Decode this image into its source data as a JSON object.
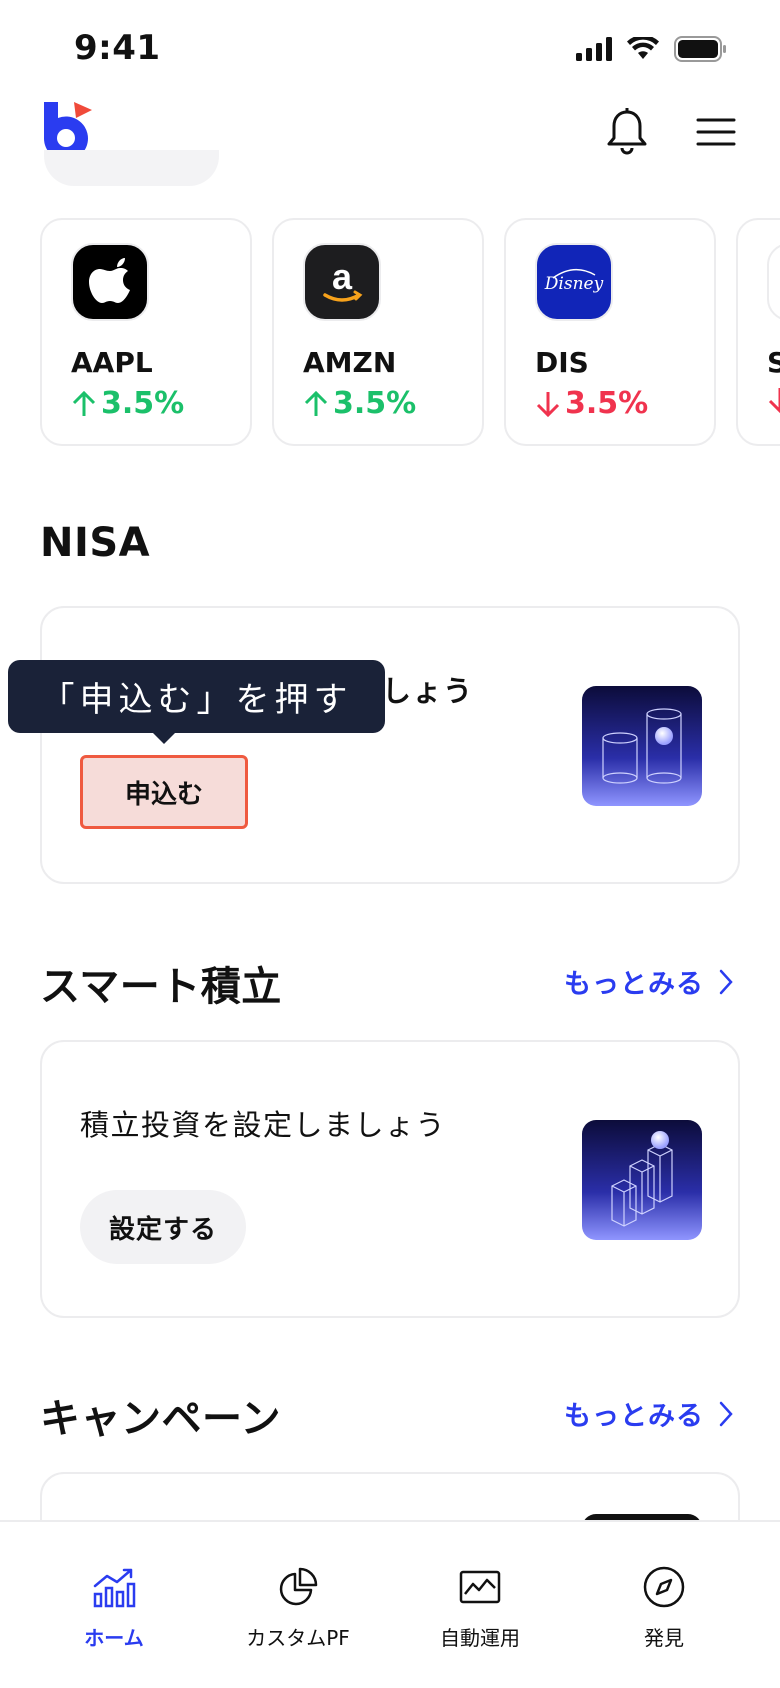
{
  "status_bar": {
    "time": "9:41"
  },
  "header": {
    "logo": "app-logo",
    "bell_icon": "bell-icon",
    "menu_icon": "hamburger-menu-icon"
  },
  "stocks": [
    {
      "ticker": "AAPL",
      "change": "3.5%",
      "direction": "up",
      "logo": "apple-logo"
    },
    {
      "ticker": "AMZN",
      "change": "3.5%",
      "direction": "up",
      "logo": "amazon-logo"
    },
    {
      "ticker": "DIS",
      "change": "3.5%",
      "direction": "down",
      "logo": "disney-logo"
    },
    {
      "ticker": "S",
      "change": "",
      "direction": "down",
      "logo": "partial-logo"
    }
  ],
  "nisa": {
    "title": "NISA",
    "card_text_tail": "しょう",
    "apply_label": "申込む",
    "tooltip": "「申込む」を押す"
  },
  "smart": {
    "title": "スマート積立",
    "more_label": "もっとみる",
    "card_text": "積立投資を設定しましょう",
    "button_label": "設定する"
  },
  "campaign": {
    "title": "キャンペーン",
    "more_label": "もっとみる"
  },
  "tabs": [
    {
      "label": "ホーム",
      "icon": "chart-home-icon",
      "active": true
    },
    {
      "label": "カスタムPF",
      "icon": "pie-chart-icon",
      "active": false
    },
    {
      "label": "自動運用",
      "icon": "line-chart-icon",
      "active": false
    },
    {
      "label": "発見",
      "icon": "compass-icon",
      "active": false
    }
  ],
  "colors": {
    "accent": "#2a3cf0",
    "up": "#1bc06a",
    "down": "#f0334e",
    "tooltip_bg": "#1a2238",
    "highlight_border": "#ef5a40"
  }
}
